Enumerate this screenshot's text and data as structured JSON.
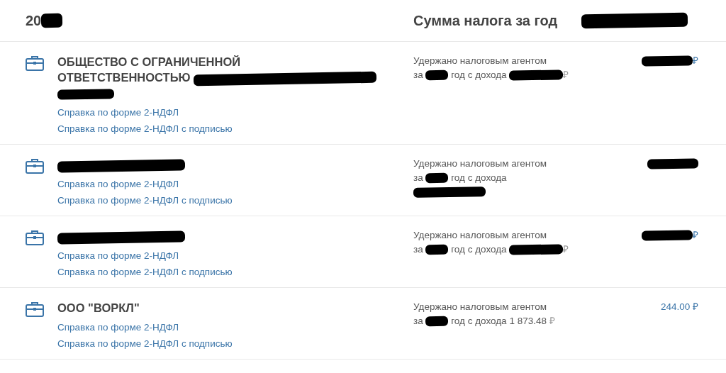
{
  "header": {
    "year": "20",
    "year_redacted": true,
    "title": "Сумма налога за год",
    "total_redacted": true
  },
  "employers": [
    {
      "name": "ОБЩЕСТВО С ОГРАНИЧЕННОЙ ОТВЕТСТВЕННОСТЬЮ",
      "name_redacted": true,
      "links": [
        "Справка по форме 2-НДФЛ",
        "Справка по форме 2-НДФЛ с подписью"
      ],
      "withheld": {
        "line": "Удержано налоговым агентом",
        "for": "за",
        "year_redacted": true,
        "income_label": "год с дохода",
        "income_redacted": true,
        "income_currency": "₽"
      },
      "tax": {
        "redacted": true,
        "currency": "₽"
      }
    },
    {
      "name_redacted": true,
      "links": [
        "Справка по форме 2-НДФЛ",
        "Справка по форме 2-НДФЛ с подписью"
      ],
      "withheld": {
        "line": "Удержано налоговым агентом",
        "for": "за",
        "year_redacted": true,
        "income_label": "год с дохода",
        "income_redacted": true,
        "income_wrap": true
      },
      "tax": {
        "redacted": true
      }
    },
    {
      "name_redacted": true,
      "links": [
        "Справка по форме 2-НДФЛ",
        "Справка по форме 2-НДФЛ с подписью"
      ],
      "withheld": {
        "line": "Удержано налоговым агентом",
        "for": "за",
        "year_redacted": true,
        "income_label": "год с дохода",
        "income_redacted": true,
        "income_currency": "₽"
      },
      "tax": {
        "redacted": true,
        "currency": "₽"
      }
    },
    {
      "name": "ООО \"ВОРКЛ\"",
      "name_redacted": false,
      "links": [
        "Справка по форме 2-НДФЛ",
        "Справка по форме 2-НДФЛ с подписью"
      ],
      "withheld": {
        "line": "Удержано налоговым агентом",
        "for": "за",
        "year_redacted": true,
        "income_label": "год с дохода",
        "income": "1 873.48",
        "income_redacted": false,
        "income_currency": "₽"
      },
      "tax": {
        "amount": "244.00",
        "redacted": false,
        "currency": "₽"
      }
    }
  ]
}
